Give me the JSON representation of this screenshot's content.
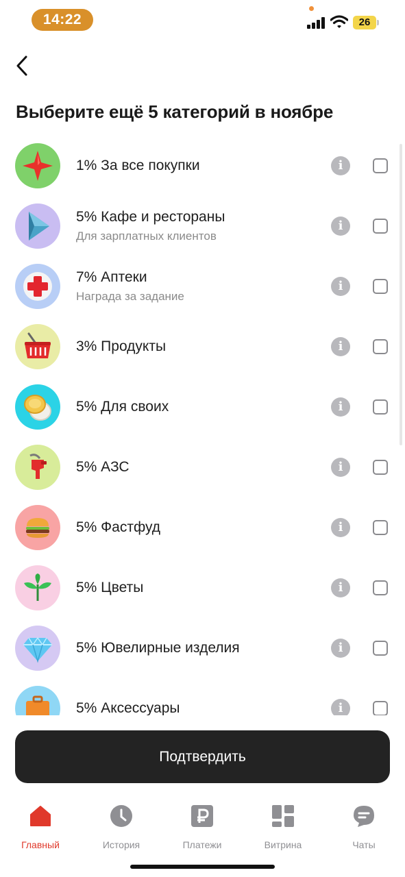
{
  "status_bar": {
    "time": "14:22",
    "battery": "26",
    "icons": [
      "signal-icon",
      "wifi-icon",
      "battery-icon"
    ]
  },
  "header": {
    "back_icon": "chevron-left-icon",
    "title": "Выберите ещё 5 категорий в ноябре"
  },
  "categories": [
    {
      "title": "1% За все покупки",
      "subtitle": "",
      "icon": "red-star-icon",
      "checked": false
    },
    {
      "title": "5% Кафе и рестораны",
      "subtitle": "Для зарплатных клиентов",
      "icon": "play-triangle-icon",
      "checked": false
    },
    {
      "title": "7% Аптеки",
      "subtitle": "Награда за задание",
      "icon": "medical-cross-icon",
      "checked": false
    },
    {
      "title": "3% Продукты",
      "subtitle": "",
      "icon": "shopping-basket-icon",
      "checked": false
    },
    {
      "title": "5% Для своих",
      "subtitle": "",
      "icon": "coins-icon",
      "checked": false
    },
    {
      "title": "5% АЗС",
      "subtitle": "",
      "icon": "fuel-nozzle-icon",
      "checked": false
    },
    {
      "title": "5% Фастфуд",
      "subtitle": "",
      "icon": "burger-icon",
      "checked": false
    },
    {
      "title": "5% Цветы",
      "subtitle": "",
      "icon": "leaves-icon",
      "checked": false
    },
    {
      "title": "5% Ювелирные изделия",
      "subtitle": "",
      "icon": "diamond-icon",
      "checked": false
    },
    {
      "title": "5% Аксессуары",
      "subtitle": "",
      "icon": "briefcase-icon",
      "checked": false
    }
  ],
  "confirm_label": "Подтвердить",
  "tabs": [
    {
      "label": "Главный",
      "icon": "home-icon",
      "active": true
    },
    {
      "label": "История",
      "icon": "clock-icon",
      "active": false
    },
    {
      "label": "Платежи",
      "icon": "ruble-icon",
      "active": false
    },
    {
      "label": "Витрина",
      "icon": "grid-icon",
      "active": false
    },
    {
      "label": "Чаты",
      "icon": "chat-bubble-icon",
      "active": false
    }
  ],
  "colors": {
    "accent": "#e0392b",
    "button": "#232323",
    "time_pill": "#d9902a",
    "battery": "#f3d54a"
  }
}
